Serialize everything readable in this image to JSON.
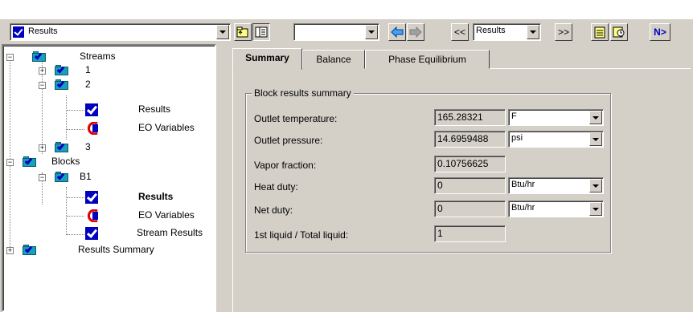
{
  "toolbar": {
    "context_combo": "Results",
    "blank_combo": "",
    "nav_combo": "Results",
    "prev_form_label": "<<",
    "next_form_label": ">>",
    "next_label": "N>"
  },
  "tree": {
    "streams": "Streams",
    "stream_1": "1",
    "stream_2": "2",
    "stream_2_results": "Results",
    "stream_2_eo": "EO Variables",
    "stream_3": "3",
    "blocks": "Blocks",
    "block_b1": "B1",
    "b1_results": "Results",
    "b1_eo": "EO Variables",
    "b1_stream_results": "Stream Results",
    "results_summary": "Results Summary"
  },
  "tabs": [
    "Summary",
    "Balance",
    "Phase Equilibrium"
  ],
  "group_title": "Block results summary",
  "fields": [
    {
      "label": "Outlet temperature:",
      "value": "165.28321",
      "unit": "F"
    },
    {
      "label": "Outlet pressure:",
      "value": "14.6959488",
      "unit": "psi"
    },
    {
      "label": "Vapor fraction:",
      "value": "0.10756625"
    },
    {
      "label": "Heat duty:",
      "value": "0",
      "unit": "Btu/hr"
    },
    {
      "label": "Net duty:",
      "value": "0",
      "unit": "Btu/hr"
    },
    {
      "label": "1st liquid / Total liquid:",
      "value": "1"
    }
  ],
  "colors": {
    "panel": "#d4d0c8",
    "check_blue": "#0000c0",
    "folder_teal": "#1a9fb8"
  }
}
